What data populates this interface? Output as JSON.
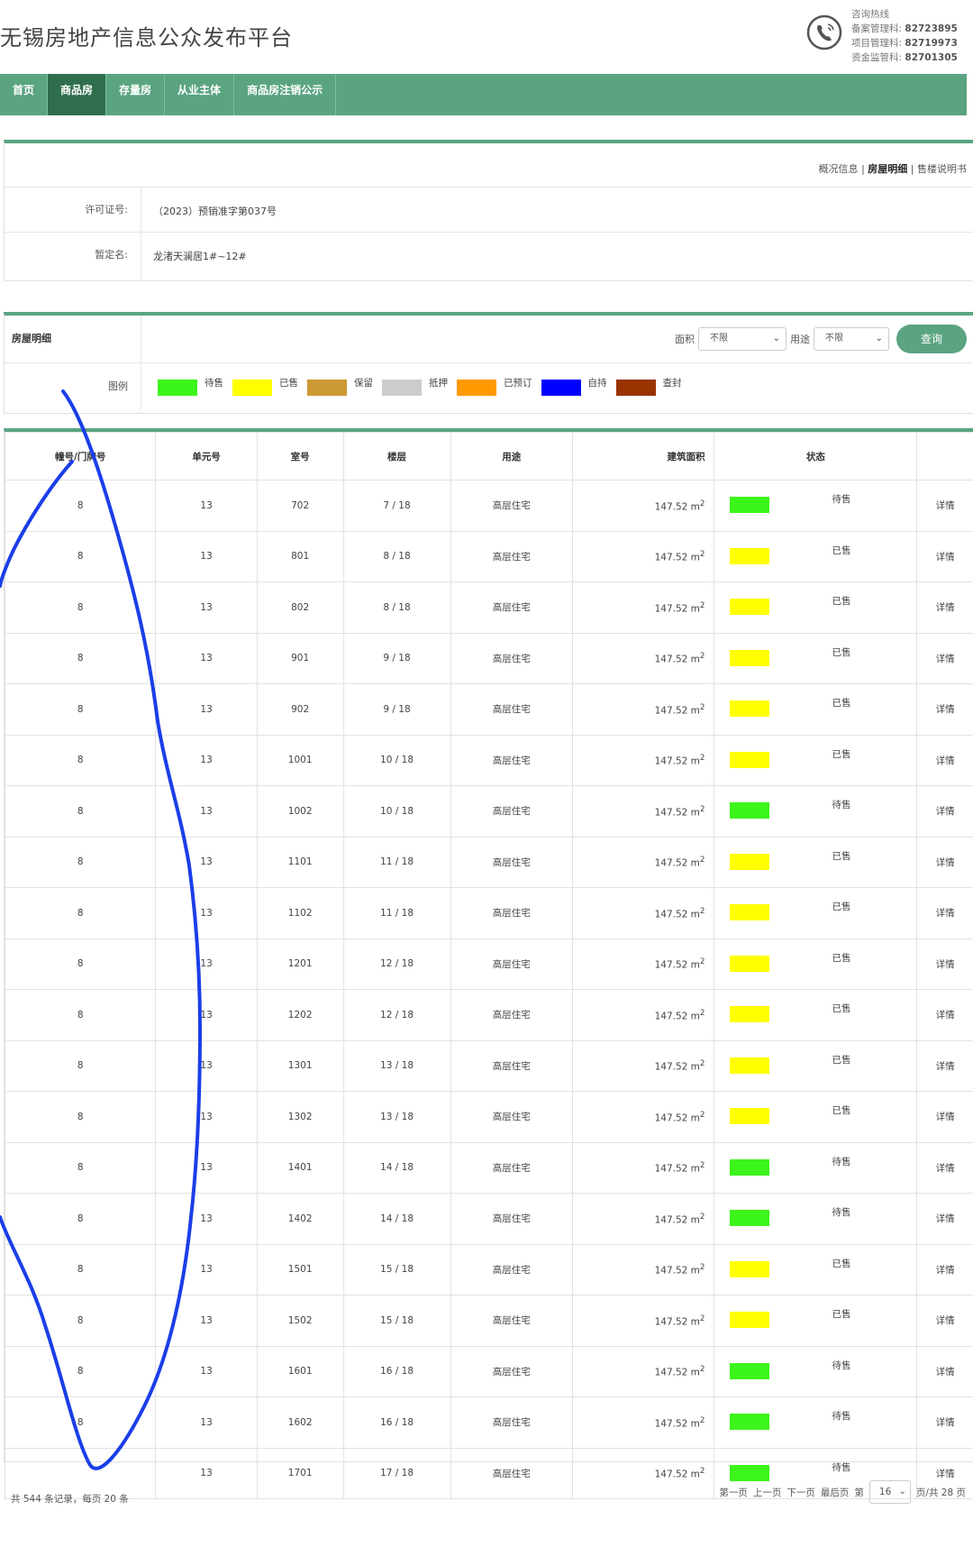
{
  "site": {
    "title": "无锡房地产信息公众发布平台"
  },
  "hotline": {
    "title": "咨询热线",
    "lines": [
      {
        "label": "备案管理科:",
        "number": "82723895"
      },
      {
        "label": "项目管理科:",
        "number": "82719973"
      },
      {
        "label": "资金监管科:",
        "number": "82701305"
      }
    ]
  },
  "nav": [
    {
      "label": "首页",
      "active": false
    },
    {
      "label": "商品房",
      "active": true
    },
    {
      "label": "存量房",
      "active": false
    },
    {
      "label": "从业主体",
      "active": false
    },
    {
      "label": "商品房注销公示",
      "active": false
    }
  ],
  "project": {
    "links": {
      "overview": "概况信息",
      "detail": "房屋明细",
      "manual": "售楼说明书",
      "sep": "|"
    },
    "license_label": "许可证号:",
    "license_value": "（2023）预销准字第037号",
    "name_label": "暂定名:",
    "name_value": "龙渚天澜居1#~12#"
  },
  "filter": {
    "title": "房屋明细",
    "area_label": "面积",
    "area_value": "不限",
    "use_label": "用途",
    "use_value": "不限",
    "query_label": "查询",
    "legend_label": "图例"
  },
  "legend": [
    {
      "label": "待售",
      "color": "#3cf51a"
    },
    {
      "label": "已售",
      "color": "#ffff00"
    },
    {
      "label": "保留",
      "color": "#cc9933"
    },
    {
      "label": "抵押",
      "color": "#cccccc"
    },
    {
      "label": "已预订",
      "color": "#ff9900"
    },
    {
      "label": "自持",
      "color": "#0000ff"
    },
    {
      "label": "查封",
      "color": "#993300"
    }
  ],
  "table": {
    "headers": [
      "幢号/门牌号",
      "单元号",
      "室号",
      "楼层",
      "用途",
      "建筑面积",
      "状态",
      ""
    ],
    "detail_label": "详情",
    "area_unit": "m",
    "area_sup": "2",
    "rows": [
      {
        "bld": "8",
        "unit": "13",
        "room": "702",
        "floor": "7 / 18",
        "use": "高层住宅",
        "area": "147.52",
        "status": "待售",
        "color": "#3cf51a"
      },
      {
        "bld": "8",
        "unit": "13",
        "room": "801",
        "floor": "8 / 18",
        "use": "高层住宅",
        "area": "147.52",
        "status": "已售",
        "color": "#ffff00"
      },
      {
        "bld": "8",
        "unit": "13",
        "room": "802",
        "floor": "8 / 18",
        "use": "高层住宅",
        "area": "147.52",
        "status": "已售",
        "color": "#ffff00"
      },
      {
        "bld": "8",
        "unit": "13",
        "room": "901",
        "floor": "9 / 18",
        "use": "高层住宅",
        "area": "147.52",
        "status": "已售",
        "color": "#ffff00"
      },
      {
        "bld": "8",
        "unit": "13",
        "room": "902",
        "floor": "9 / 18",
        "use": "高层住宅",
        "area": "147.52",
        "status": "已售",
        "color": "#ffff00"
      },
      {
        "bld": "8",
        "unit": "13",
        "room": "1001",
        "floor": "10 / 18",
        "use": "高层住宅",
        "area": "147.52",
        "status": "已售",
        "color": "#ffff00"
      },
      {
        "bld": "8",
        "unit": "13",
        "room": "1002",
        "floor": "10 / 18",
        "use": "高层住宅",
        "area": "147.52",
        "status": "待售",
        "color": "#3cf51a"
      },
      {
        "bld": "8",
        "unit": "13",
        "room": "1101",
        "floor": "11 / 18",
        "use": "高层住宅",
        "area": "147.52",
        "status": "已售",
        "color": "#ffff00"
      },
      {
        "bld": "8",
        "unit": "13",
        "room": "1102",
        "floor": "11 / 18",
        "use": "高层住宅",
        "area": "147.52",
        "status": "已售",
        "color": "#ffff00"
      },
      {
        "bld": "8",
        "unit": "13",
        "room": "1201",
        "floor": "12 / 18",
        "use": "高层住宅",
        "area": "147.52",
        "status": "已售",
        "color": "#ffff00"
      },
      {
        "bld": "8",
        "unit": "13",
        "room": "1202",
        "floor": "12 / 18",
        "use": "高层住宅",
        "area": "147.52",
        "status": "已售",
        "color": "#ffff00"
      },
      {
        "bld": "8",
        "unit": "13",
        "room": "1301",
        "floor": "13 / 18",
        "use": "高层住宅",
        "area": "147.52",
        "status": "已售",
        "color": "#ffff00"
      },
      {
        "bld": "8",
        "unit": "13",
        "room": "1302",
        "floor": "13 / 18",
        "use": "高层住宅",
        "area": "147.52",
        "status": "已售",
        "color": "#ffff00"
      },
      {
        "bld": "8",
        "unit": "13",
        "room": "1401",
        "floor": "14 / 18",
        "use": "高层住宅",
        "area": "147.52",
        "status": "待售",
        "color": "#3cf51a"
      },
      {
        "bld": "8",
        "unit": "13",
        "room": "1402",
        "floor": "14 / 18",
        "use": "高层住宅",
        "area": "147.52",
        "status": "待售",
        "color": "#3cf51a"
      },
      {
        "bld": "8",
        "unit": "13",
        "room": "1501",
        "floor": "15 / 18",
        "use": "高层住宅",
        "area": "147.52",
        "status": "已售",
        "color": "#ffff00"
      },
      {
        "bld": "8",
        "unit": "13",
        "room": "1502",
        "floor": "15 / 18",
        "use": "高层住宅",
        "area": "147.52",
        "status": "已售",
        "color": "#ffff00"
      },
      {
        "bld": "8",
        "unit": "13",
        "room": "1601",
        "floor": "16 / 18",
        "use": "高层住宅",
        "area": "147.52",
        "status": "待售",
        "color": "#3cf51a"
      },
      {
        "bld": "8",
        "unit": "13",
        "room": "1602",
        "floor": "16 / 18",
        "use": "高层住宅",
        "area": "147.52",
        "status": "待售",
        "color": "#3cf51a"
      },
      {
        "bld": "",
        "unit": "13",
        "room": "1701",
        "floor": "17 / 18",
        "use": "高层住宅",
        "area": "147.52",
        "status": "待售",
        "color": "#3cf51a"
      }
    ]
  },
  "pagination": {
    "summary": "共 544 条记录，每页 20 条",
    "first": "第一页",
    "prev": "上一页",
    "next": "下一页",
    "last": "最后页",
    "page_prefix": "第",
    "current_page": "16",
    "page_suffix": "页/共 28 页"
  },
  "annotation": {
    "stroke_color": "#1a3ee8"
  }
}
